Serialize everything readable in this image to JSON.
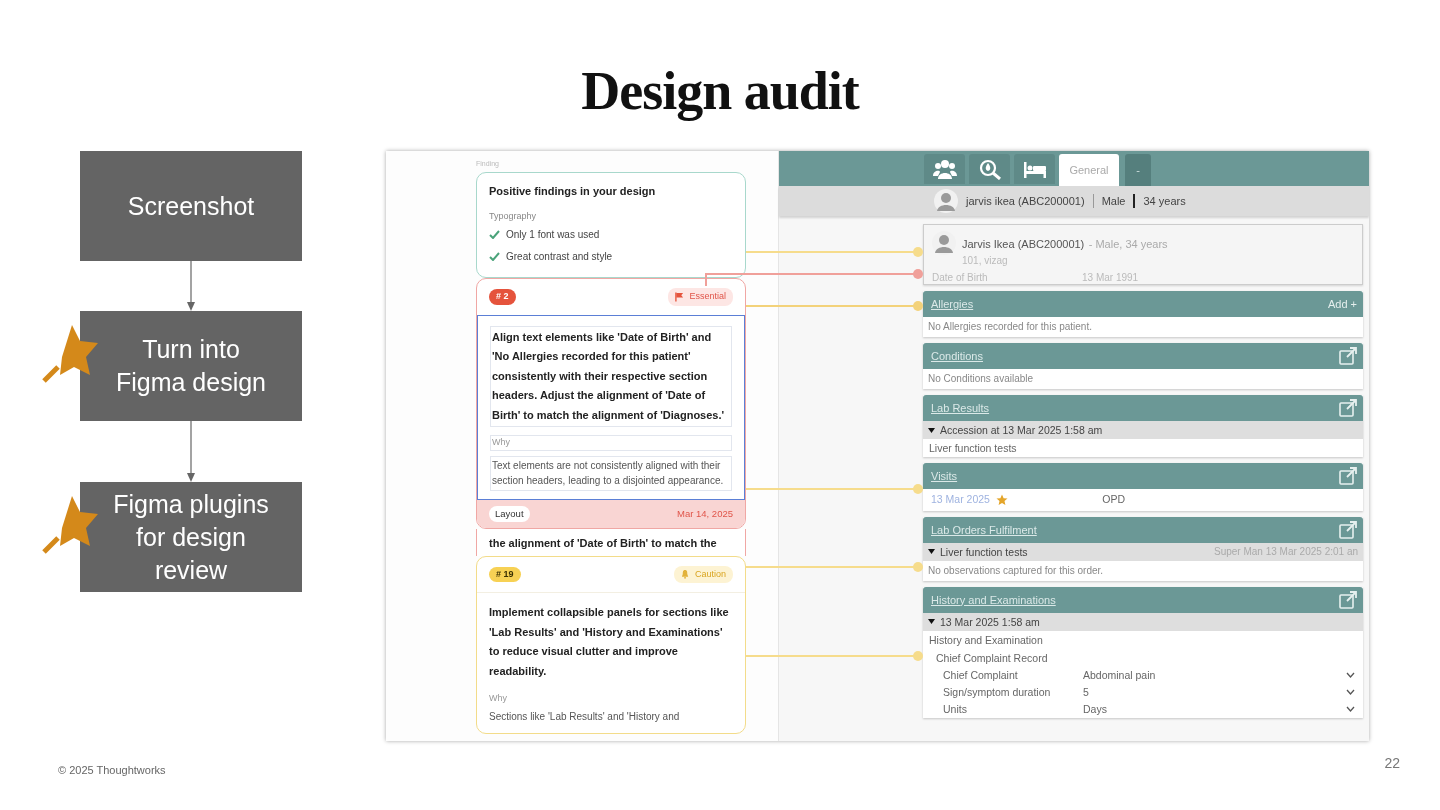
{
  "slide": {
    "title": "Design audit",
    "footer": "© 2025 Thoughtworks",
    "page_number": "22"
  },
  "flow": [
    {
      "label": "Screenshot",
      "starred": false
    },
    {
      "label": "Turn into Figma design",
      "starred": true
    },
    {
      "label": "Figma plugins for design review",
      "starred": true
    }
  ],
  "findings_panel": {
    "frame_label": "Finding",
    "positive": {
      "title": "Positive findings in your design",
      "category": "Typography",
      "items": [
        "Only 1 font was used",
        "Great contrast and style"
      ]
    },
    "findings": [
      {
        "number": "# 2",
        "kind": "essential",
        "severity_label": "Essential",
        "selected": true,
        "text": "Align text elements like 'Date of Birth' and 'No Allergies recorded for this patient' consistently with their respective section headers. Adjust the alignment of 'Date of Birth' to match the alignment of 'Diagnoses.'",
        "why_label": "Why",
        "why": "Text elements are not consistently aligned with their section headers, leading to a disjointed appearance.",
        "tag": "Layout",
        "date": "Mar 14, 2025",
        "trailing_text": "the alignment of 'Date of Birth' to match the"
      },
      {
        "number": "# 19",
        "kind": "caution",
        "severity_label": "Caution",
        "selected": false,
        "text": "Implement collapsible panels for sections like 'Lab Results' and 'History and Examinations' to reduce visual clutter and improve readability.",
        "why_label": "Why",
        "why": "Sections like 'Lab Results' and 'History and"
      }
    ]
  },
  "ehr": {
    "tabs": [
      {
        "label": "General",
        "selected": true
      },
      {
        "label": "-",
        "selected": false
      }
    ],
    "patient_bar": {
      "name": "jarvis ikea (ABC200001)",
      "gender": "Male",
      "age": "34 years"
    },
    "patient_card": {
      "name": "Jarvis Ikea (ABC200001)",
      "summary": "- Male, 34 years",
      "address": "101, vizag",
      "dob_label": "Date of Birth",
      "dob": "13 Mar 1991"
    },
    "sections": [
      {
        "title": "Allergies",
        "kind": "add",
        "action_label": "Add +",
        "rows": [
          {
            "kind": "empty",
            "text": "No Allergies recorded for this patient."
          }
        ]
      },
      {
        "title": "Conditions",
        "kind": "open",
        "rows": [
          {
            "kind": "empty",
            "text": "No Conditions available"
          }
        ]
      },
      {
        "title": "Lab Results",
        "kind": "open",
        "rows": [
          {
            "kind": "group",
            "text": "Accession at 13 Mar 2025 1:58 am",
            "expanded": true
          },
          {
            "kind": "item",
            "text": "Liver function tests"
          }
        ]
      },
      {
        "title": "Visits",
        "kind": "open",
        "rows": [
          {
            "kind": "visit",
            "date": "13 Mar 2025",
            "starred": true,
            "type": "OPD"
          }
        ]
      },
      {
        "title": "Lab Orders Fulfilment",
        "kind": "open",
        "rows": [
          {
            "kind": "group",
            "text": "Liver function tests",
            "meta": "Super Man 13 Mar 2025 2:01 an",
            "expanded": true
          },
          {
            "kind": "empty",
            "text": "No observations captured for this order."
          }
        ]
      },
      {
        "title": "History and Examinations",
        "kind": "open",
        "rows": [
          {
            "kind": "group",
            "text": "13 Mar 2025 1:58 am",
            "expanded": true
          },
          {
            "kind": "item",
            "text": "History and Examination",
            "children": [
              {
                "kind": "item",
                "text": "Chief Complaint Record",
                "children": [
                  {
                    "kind": "field",
                    "label": "Chief Complaint",
                    "value": "Abdominal pain"
                  },
                  {
                    "kind": "field",
                    "label": "Sign/symptom duration",
                    "value": "5"
                  },
                  {
                    "kind": "field",
                    "label": "Units",
                    "value": "Days"
                  }
                ]
              }
            ]
          }
        ]
      }
    ]
  }
}
